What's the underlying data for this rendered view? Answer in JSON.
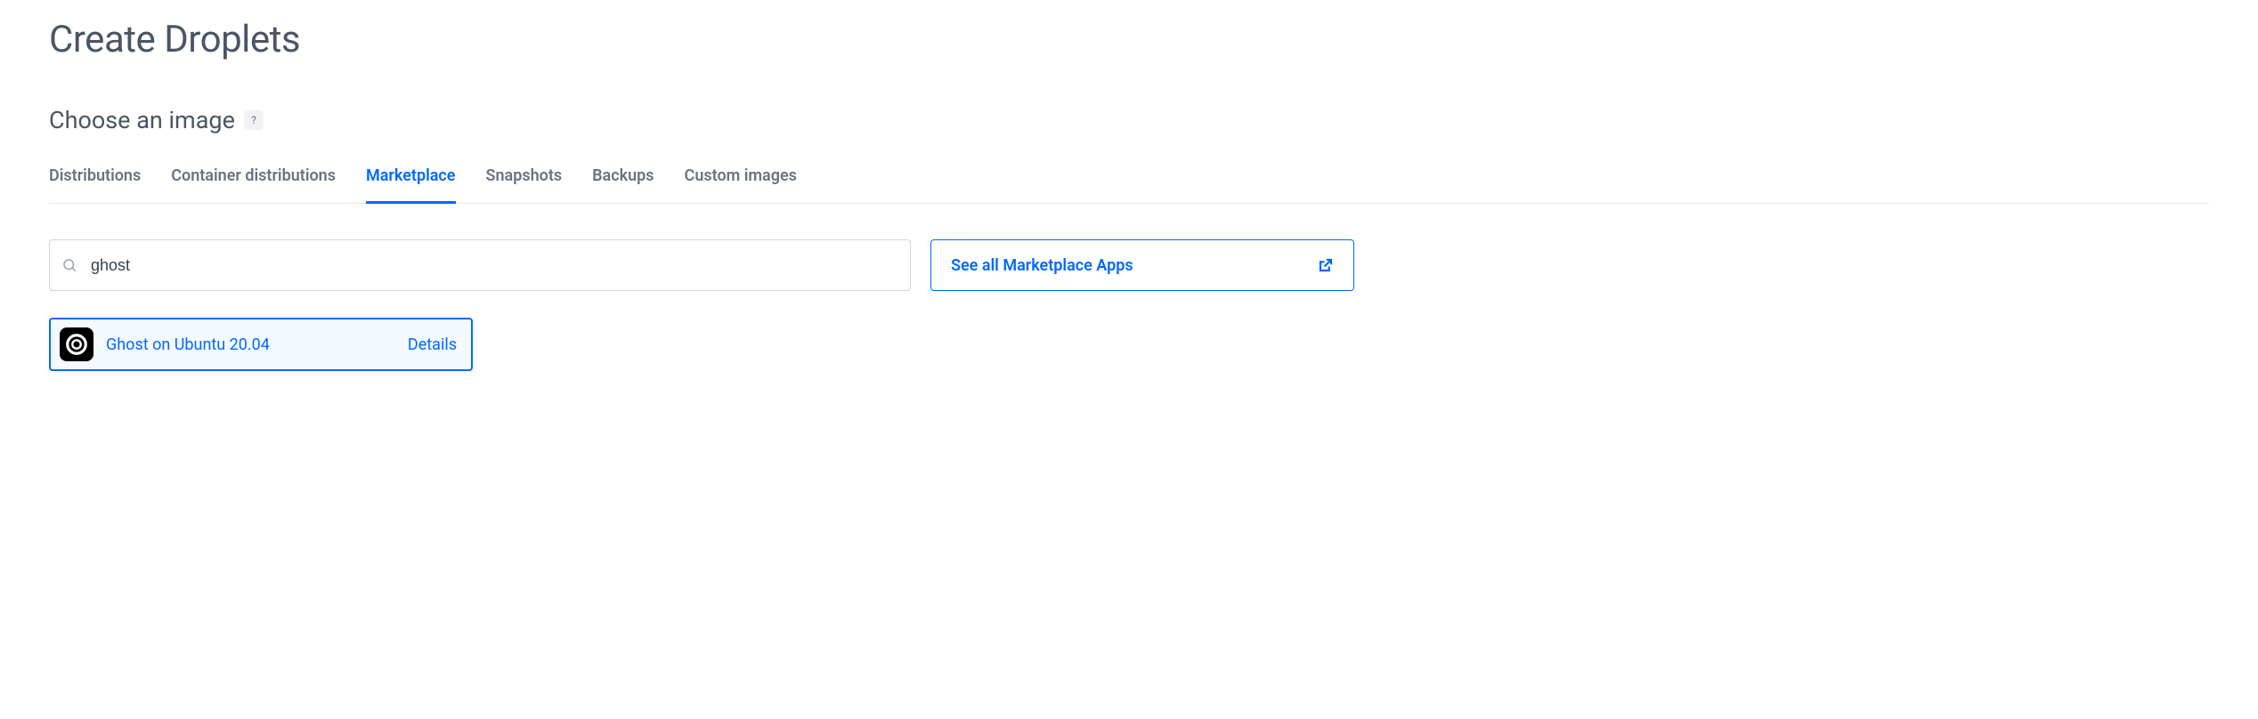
{
  "page": {
    "title": "Create Droplets"
  },
  "section": {
    "title": "Choose an image",
    "help_label": "?"
  },
  "tabs": [
    {
      "label": "Distributions",
      "active": false
    },
    {
      "label": "Container distributions",
      "active": false
    },
    {
      "label": "Marketplace",
      "active": true
    },
    {
      "label": "Snapshots",
      "active": false
    },
    {
      "label": "Backups",
      "active": false
    },
    {
      "label": "Custom images",
      "active": false
    }
  ],
  "search": {
    "value": "ghost",
    "placeholder": ""
  },
  "marketplace_button": {
    "label": "See all Marketplace Apps"
  },
  "results": [
    {
      "name": "Ghost on Ubuntu 20.04",
      "details_label": "Details",
      "icon": "ghost-icon"
    }
  ]
}
